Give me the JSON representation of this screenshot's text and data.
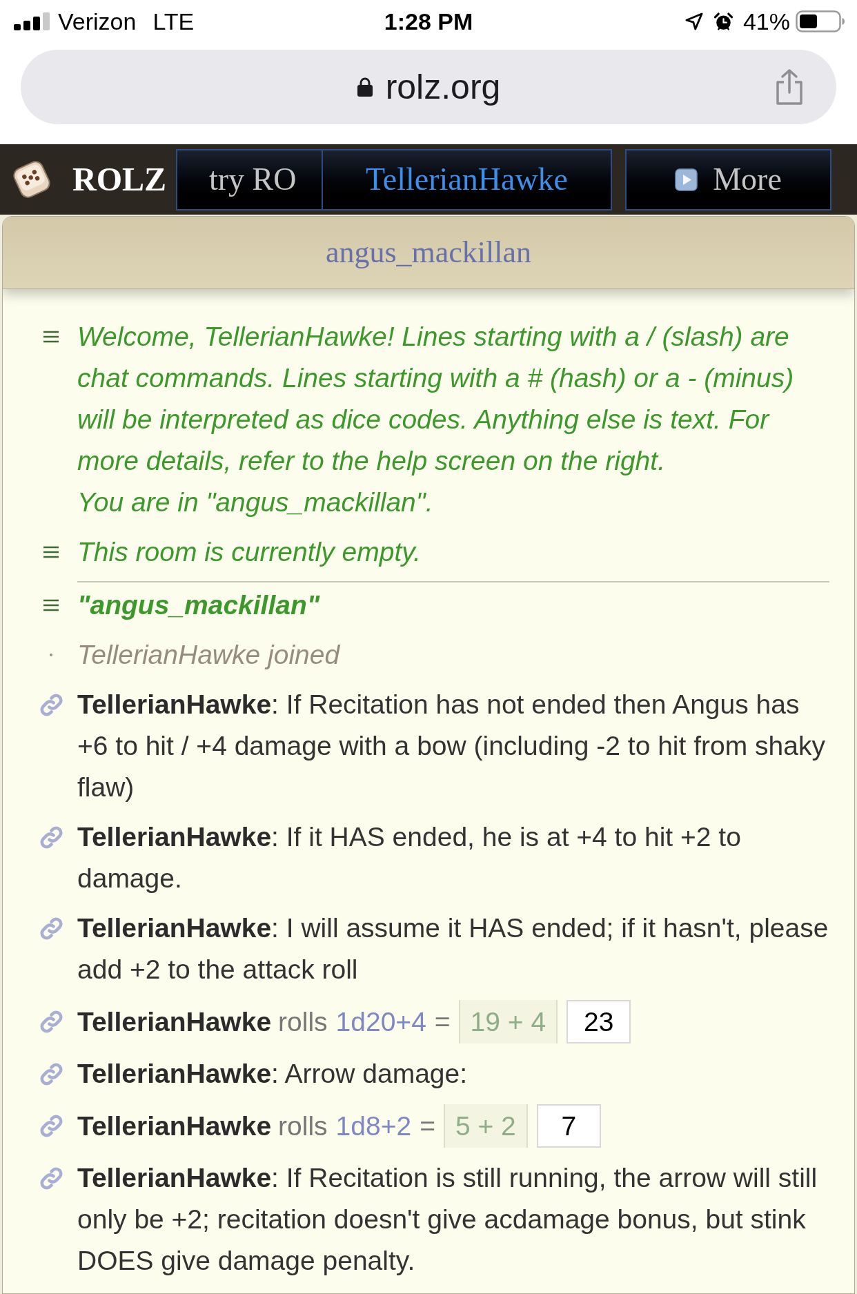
{
  "status_bar": {
    "carrier": "Verizon",
    "network": "LTE",
    "time": "1:28 PM",
    "battery": "41%"
  },
  "address_bar": {
    "url": "rolz.org"
  },
  "nav": {
    "logo": "ROLZ",
    "tabs": [
      {
        "label": "try RO",
        "selected": false
      },
      {
        "label": "TellerianHawke",
        "selected": true
      }
    ],
    "more": {
      "label": "More"
    }
  },
  "room": {
    "title": "angus_mackillan"
  },
  "messages": [
    {
      "kind": "system",
      "lines": [
        "Welcome, TellerianHawke! Lines starting with a / (slash) are chat commands. Lines starting with a # (hash) or a - (minus) will be interpreted as dice codes. Anything else is text. For more details, refer to the help screen on the right.",
        "You are in \"angus_mackillan\"."
      ]
    },
    {
      "kind": "system",
      "lines": [
        "This room is currently empty."
      ]
    },
    {
      "kind": "divider"
    },
    {
      "kind": "topic",
      "text": "\"angus_mackillan\""
    },
    {
      "kind": "event",
      "text": "TellerianHawke joined"
    },
    {
      "kind": "chat",
      "text": "**TellerianHawke**: If Recitation has not ended then Angus has +6 to hit / +4 damage with a bow (including -2 to hit from shaky flaw)"
    },
    {
      "kind": "chat",
      "text": "**TellerianHawke**: If it HAS ended, he is at +4 to hit +2 to damage."
    },
    {
      "kind": "chat",
      "text": "**TellerianHawke**: I will assume it HAS ended; if it hasn't, please add +2 to the attack roll"
    },
    {
      "kind": "roll",
      "user": "TellerianHawke",
      "verb": "rolls",
      "code": "1d20+4",
      "equals": "=",
      "dice": "19 + 4",
      "total": "23"
    },
    {
      "kind": "chat",
      "text": "**TellerianHawke**: Arrow damage:"
    },
    {
      "kind": "roll",
      "user": "TellerianHawke",
      "verb": "rolls",
      "code": "1d8+2",
      "equals": "=",
      "dice": "5 + 2",
      "total": "7"
    },
    {
      "kind": "chat",
      "text": "**TellerianHawke**: If Recitation is still running, the arrow will still only be +2; recitation doesn't give acdamage bonus, but stink DOES give damage penalty."
    }
  ]
}
